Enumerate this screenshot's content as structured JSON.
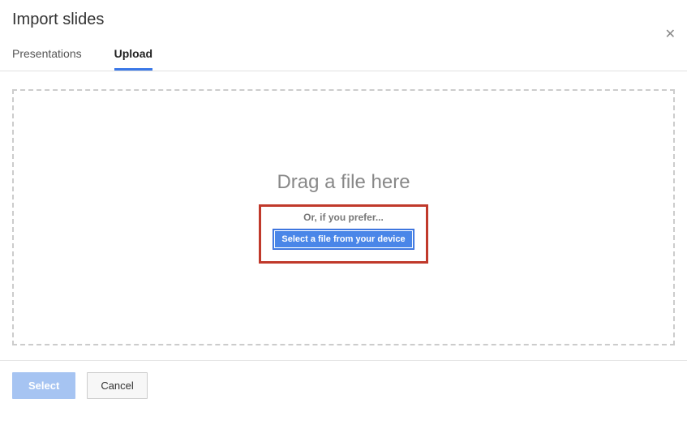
{
  "dialog": {
    "title": "Import slides"
  },
  "tabs": {
    "presentations": "Presentations",
    "upload": "Upload"
  },
  "dropzone": {
    "drag_text": "Drag a file here",
    "prefer_text": "Or, if you prefer...",
    "select_device_btn": "Select a file from your device"
  },
  "footer": {
    "select_btn": "Select",
    "cancel_btn": "Cancel"
  }
}
